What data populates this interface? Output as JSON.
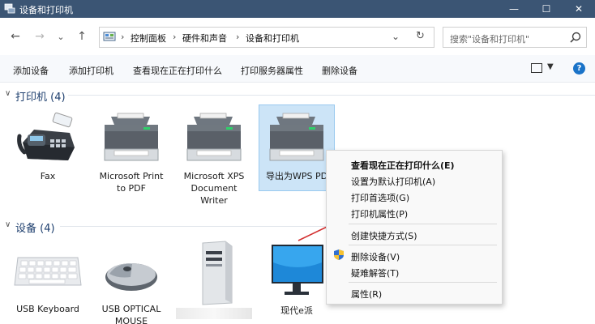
{
  "window": {
    "title": "设备和打印机",
    "minimize_glyph": "—",
    "maximize_glyph": "☐",
    "close_glyph": "✕"
  },
  "nav": {
    "back": "←",
    "forward": "→",
    "recent": "⌄",
    "up": "↑"
  },
  "address": {
    "crumbs": [
      "控制面板",
      "硬件和声音",
      "设备和打印机"
    ],
    "separator": "›",
    "dropdown": "⌄",
    "refresh": "↻"
  },
  "search": {
    "placeholder": "搜索\"设备和打印机\""
  },
  "toolbar": {
    "items": [
      "添加设备",
      "添加打印机",
      "查看现在正在打印什么",
      "打印服务器属性",
      "删除设备"
    ],
    "view_dropdown": "▼",
    "help": "?"
  },
  "groups": {
    "printers": {
      "chevron": "∨",
      "title": "打印机 (4)"
    },
    "devices": {
      "chevron": "∨",
      "title": "设备 (4)"
    }
  },
  "printers": [
    {
      "lines": [
        "Fax"
      ],
      "icon": "fax-icon"
    },
    {
      "lines": [
        "Microsoft Print",
        "to PDF"
      ],
      "icon": "printer-icon"
    },
    {
      "lines": [
        "Microsoft XPS",
        "Document",
        "Writer"
      ],
      "icon": "printer-icon"
    },
    {
      "lines": [
        "导出为WPS PDF"
      ],
      "icon": "printer-icon",
      "selected": true
    }
  ],
  "devices": [
    {
      "lines": [
        "USB Keyboard"
      ],
      "icon": "keyboard-icon"
    },
    {
      "lines": [
        "USB OPTICAL",
        "MOUSE"
      ],
      "icon": "mouse-icon"
    },
    {
      "lines": [
        ""
      ],
      "icon": "computer-tower-icon"
    },
    {
      "lines": [
        "现代e派"
      ],
      "icon": "monitor-icon"
    }
  ],
  "context_menu": {
    "items": [
      {
        "label": "查看现在正在打印什么(E)",
        "bold": true
      },
      {
        "label": "设置为默认打印机(A)"
      },
      {
        "label": "打印首选项(G)"
      },
      {
        "label": "打印机属性(P)"
      },
      {
        "label": "创建快捷方式(S)"
      },
      {
        "label": "删除设备(V)",
        "icon": "shield-icon"
      },
      {
        "label": "疑难解答(T)"
      },
      {
        "label": "属性(R)"
      }
    ]
  },
  "colors": {
    "titlebar": "#3b5574",
    "selection": "#cce4f7",
    "group_title": "#1e3f6e",
    "annotation_arrow": "#d32f2f"
  }
}
